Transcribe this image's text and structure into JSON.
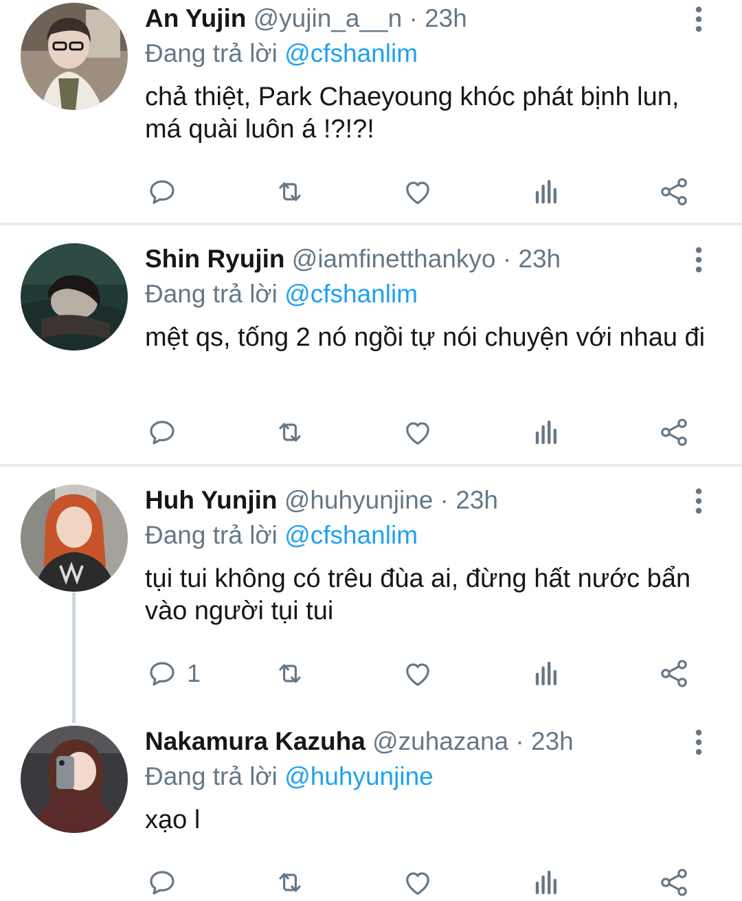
{
  "tweets": [
    {
      "name": "An Yujin",
      "handle": "@yujin_a__n",
      "separator": "·",
      "time": "23h",
      "reply_prefix": "Đang trả lời",
      "reply_to": "@cfshanlim",
      "text": "chả thiệt, Park Chaeyoung khóc phát bịnh lun, má quài luôn á !?!?!",
      "reply_count": ""
    },
    {
      "name": "Shin Ryujin",
      "handle": "@iamfinetthankyo",
      "separator": "·",
      "time": "23h",
      "reply_prefix": "Đang trả lời",
      "reply_to": "@cfshanlim",
      "text": "mệt qs, tống 2 nó ngồi tự nói chuyện với nhau đi",
      "reply_count": ""
    },
    {
      "name": "Huh Yunjin",
      "handle": "@huhyunjine",
      "separator": "·",
      "time": "23h",
      "reply_prefix": "Đang trả lời",
      "reply_to": "@cfshanlim",
      "text": "tụi tui không có trêu đùa ai, đừng hất nước bẩn vào người tụi tui",
      "reply_count": "1"
    },
    {
      "name": "Nakamura Kazuha",
      "handle": "@zuhazana",
      "separator": "·",
      "time": "23h",
      "reply_prefix": "Đang trả lời",
      "reply_to": "@huhyunjine",
      "text": "xạo l",
      "reply_count": ""
    }
  ],
  "icons": {
    "reply": "reply-icon",
    "retweet": "retweet-icon",
    "like": "like-icon",
    "analytics": "analytics-icon",
    "share": "share-icon",
    "more": "more-options-icon"
  },
  "colors": {
    "accent": "#1da1f2",
    "secondary_text": "#657786",
    "icon": "#657786",
    "divider": "#e6ecf0",
    "thread_line": "#ccd6dd"
  }
}
